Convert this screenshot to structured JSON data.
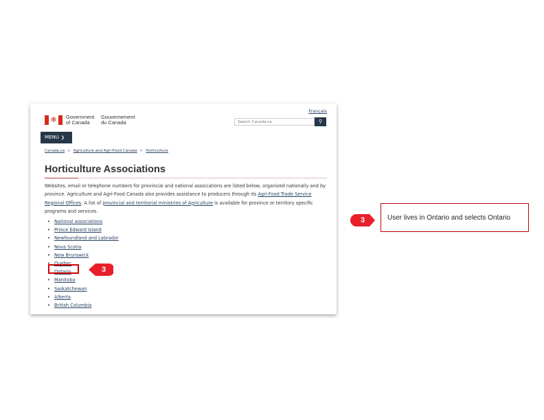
{
  "header": {
    "language_link": "Français",
    "gov_en_line1": "Government",
    "gov_en_line2": "of Canada",
    "gov_fr_line1": "Gouvernement",
    "gov_fr_line2": "du Canada",
    "search_placeholder": "Search Canada.ca",
    "search_icon": "magnifier-icon",
    "menu_label": "MENU"
  },
  "breadcrumb": [
    "Canada.ca",
    "Agriculture and Agri-Food Canada",
    "Horticulture"
  ],
  "page": {
    "title": "Horticulture Associations",
    "intro_1": "Websites, email or telephone numbers for provincial and national associations are listed below, organized nationally and by province. Agriculture and Agri-Food Canada also provides assistance to producers through its ",
    "intro_link_1": "Agri-Food Trade Service Regional Offices",
    "intro_2": ". A list of ",
    "intro_link_2": "provincial and territorial ministries of Agriculture",
    "intro_3": " is available for province or territory specific programs and services."
  },
  "links": [
    "National associations",
    "Prince Edward Island",
    "Newfoundland and Labrador",
    "Nova Scotia",
    "New Brunswick",
    "Quebec",
    "Ontario",
    "Manitoba",
    "Saskatchewan",
    "Alberta",
    "British Columbia"
  ],
  "annotation": {
    "step_number": "3",
    "callout_text": "User lives in  Ontario and selects Ontario",
    "accent_color": "#e8202a"
  }
}
